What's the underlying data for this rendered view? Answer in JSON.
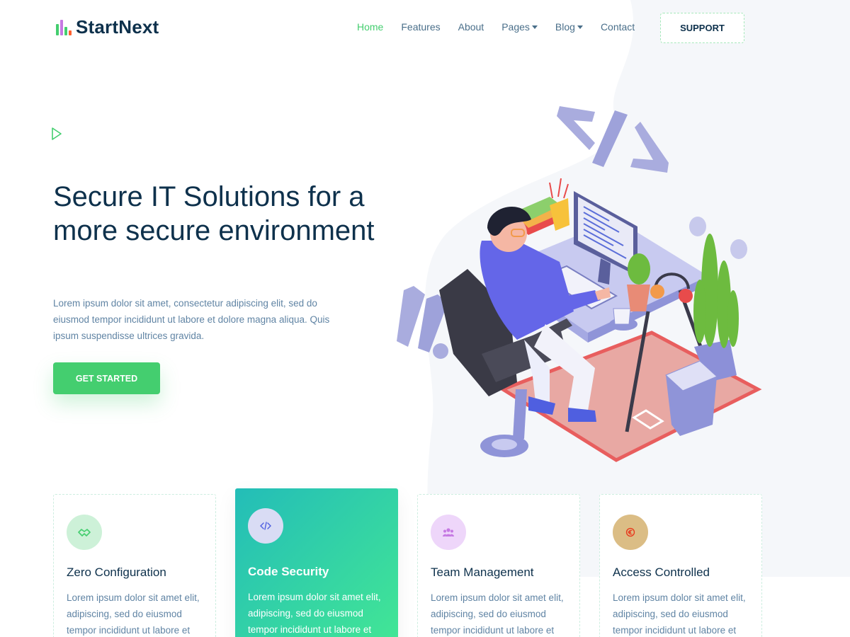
{
  "brand": {
    "name": "StartNext",
    "accent": "#44ce6f",
    "logo_colors": [
      "#44ce6f",
      "#c679e3",
      "#44ce6f",
      "#ff612f"
    ]
  },
  "nav": {
    "items": [
      {
        "label": "Home",
        "active": true,
        "dropdown": false
      },
      {
        "label": "Features",
        "active": false,
        "dropdown": false
      },
      {
        "label": "About",
        "active": false,
        "dropdown": false
      },
      {
        "label": "Pages",
        "active": false,
        "dropdown": true
      },
      {
        "label": "Blog",
        "active": false,
        "dropdown": true
      },
      {
        "label": "Contact",
        "active": false,
        "dropdown": false
      }
    ],
    "support_label": "SUPPORT"
  },
  "hero": {
    "title": "Secure IT Solutions for a more secure environment",
    "text": "Lorem ipsum dolor sit amet, consectetur adipiscing elit, sed do eiusmod tempor incididunt ut labore et dolore magna aliqua. Quis ipsum suspendisse ultrices gravida.",
    "cta_label": "GET STARTED",
    "play_icon": "play-triangle-icon",
    "illustration": "developer-at-desk-illustration"
  },
  "features": [
    {
      "title": "Zero Configuration",
      "text": "Lorem ipsum dolor sit amet elit, adipiscing, sed do eiusmod tempor incididunt ut labore et dolore.",
      "icon": "handshake-icon",
      "icon_bg": "#cdf1d8",
      "icon_color": "#44ce6f",
      "highlight": false
    },
    {
      "title": "Code Security",
      "text": "Lorem ipsum dolor sit amet elit, adipiscing, sed do eiusmod tempor incididunt ut labore et dolore.",
      "icon": "code-icon",
      "icon_bg": "#d9dcf4",
      "icon_color": "#4f5fe0",
      "highlight": true
    },
    {
      "title": "Team Management",
      "text": "Lorem ipsum dolor sit amet elit, adipiscing, sed do eiusmod tempor incididunt ut labore et dolore.",
      "icon": "users-icon",
      "icon_bg": "#eed6fa",
      "icon_color": "#c679e3",
      "highlight": false
    },
    {
      "title": "Access Controlled",
      "text": "Lorem ipsum dolor sit amet elit, adipiscing, sed do eiusmod tempor incididunt ut labore et dolore.",
      "icon": "lock-euro-icon",
      "icon_bg": "#dbbd85",
      "icon_color": "#e8351a",
      "highlight": false
    }
  ]
}
